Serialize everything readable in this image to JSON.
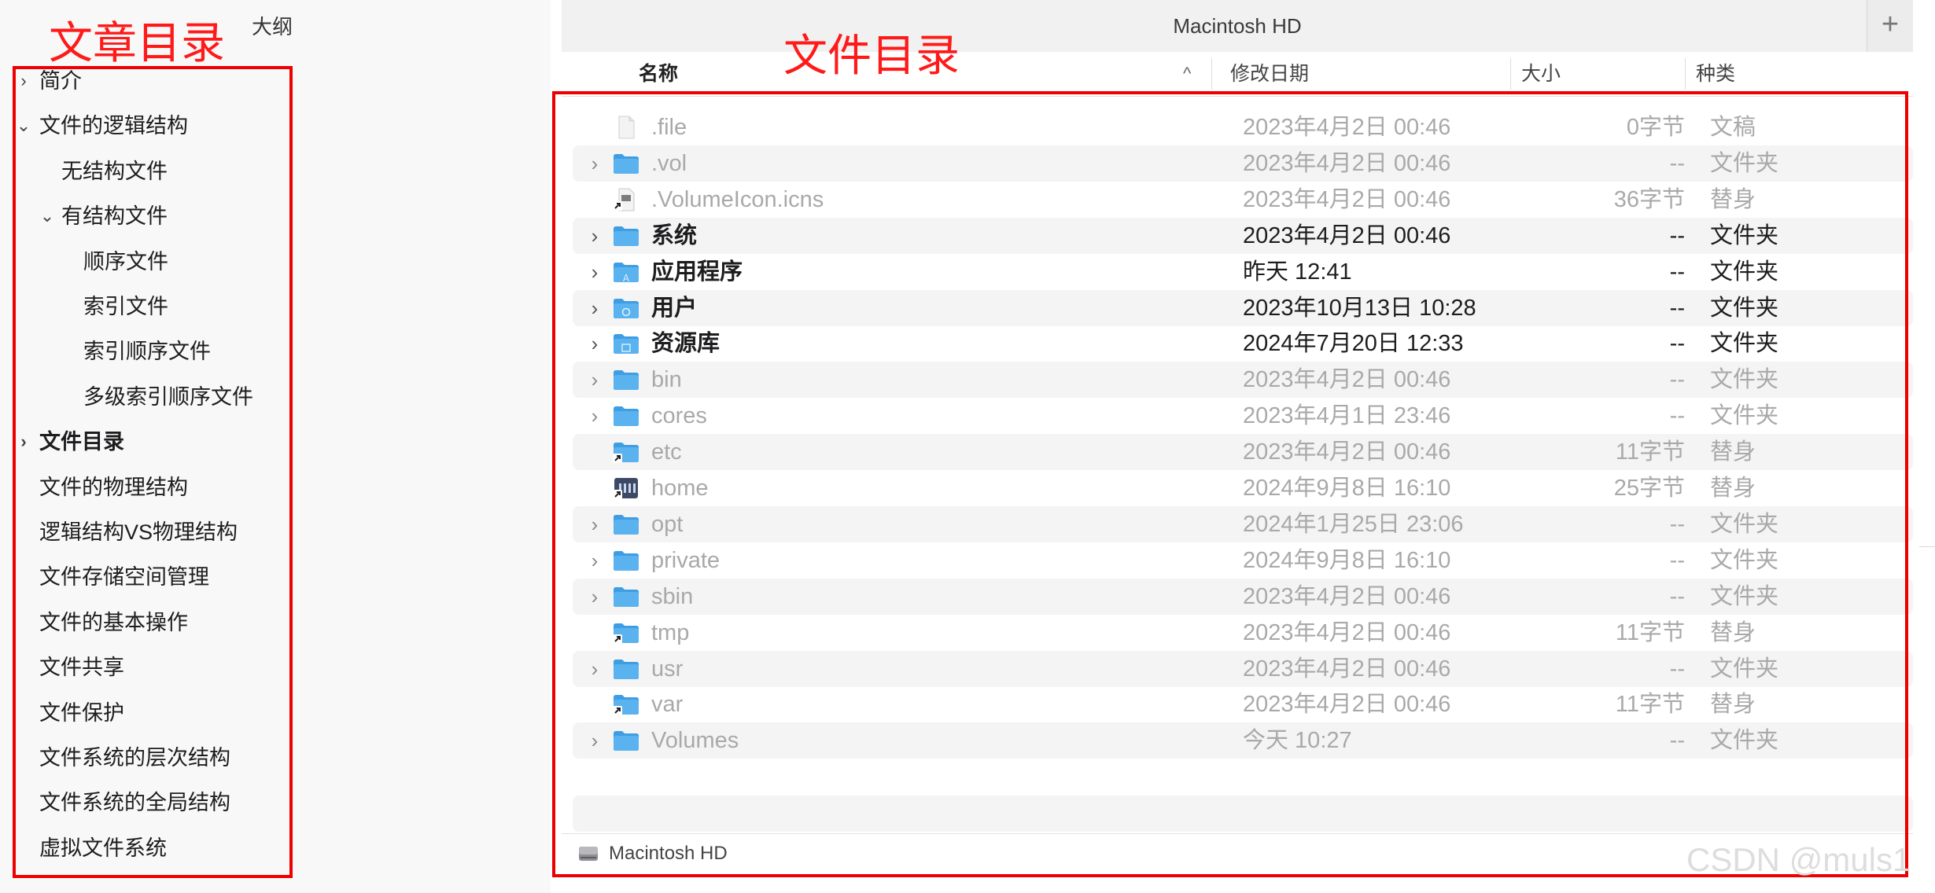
{
  "outline": {
    "header": "大纲",
    "items": [
      {
        "label": "简介",
        "chevron": "›",
        "level": 0,
        "bold": false
      },
      {
        "label": "文件的逻辑结构",
        "chevron": "⌄",
        "level": 0,
        "bold": false
      },
      {
        "label": "无结构文件",
        "chevron": "",
        "level": 1,
        "bold": false
      },
      {
        "label": "有结构文件",
        "chevron": "⌄",
        "level": 1,
        "bold": false
      },
      {
        "label": "顺序文件",
        "chevron": "",
        "level": 2,
        "bold": false
      },
      {
        "label": "索引文件",
        "chevron": "",
        "level": 2,
        "bold": false
      },
      {
        "label": "索引顺序文件",
        "chevron": "",
        "level": 2,
        "bold": false
      },
      {
        "label": "多级索引顺序文件",
        "chevron": "",
        "level": 2,
        "bold": false
      },
      {
        "label": "文件目录",
        "chevron": "›",
        "level": 0,
        "bold": true
      },
      {
        "label": "文件的物理结构",
        "chevron": "",
        "level": 0,
        "bold": false
      },
      {
        "label": "逻辑结构VS物理结构",
        "chevron": "",
        "level": 0,
        "bold": false
      },
      {
        "label": "文件存储空间管理",
        "chevron": "",
        "level": 0,
        "bold": false
      },
      {
        "label": "文件的基本操作",
        "chevron": "",
        "level": 0,
        "bold": false
      },
      {
        "label": "文件共享",
        "chevron": "",
        "level": 0,
        "bold": false
      },
      {
        "label": "文件保护",
        "chevron": "",
        "level": 0,
        "bold": false
      },
      {
        "label": "文件系统的层次结构",
        "chevron": "",
        "level": 0,
        "bold": false
      },
      {
        "label": "文件系统的全局结构",
        "chevron": "",
        "level": 0,
        "bold": false
      },
      {
        "label": "虚拟文件系统",
        "chevron": "",
        "level": 0,
        "bold": false
      }
    ]
  },
  "annotations": {
    "article_toc": "文章目录",
    "file_directory": "文件目录",
    "color": "#ff1a1a"
  },
  "finder": {
    "title": "Macintosh HD",
    "add_button": "+",
    "columns": {
      "name": "名称",
      "date": "修改日期",
      "size": "大小",
      "kind": "种类",
      "sort_indicator": "^"
    },
    "rows": [
      {
        "name": ".file",
        "date": "2023年4月2日 00:46",
        "size": "0字节",
        "kind": "文稿",
        "expandable": false,
        "icon": "document-icon",
        "style": "dim"
      },
      {
        "name": ".vol",
        "date": "2023年4月2日 00:46",
        "size": "--",
        "kind": "文件夹",
        "expandable": true,
        "icon": "folder-icon",
        "style": "dim"
      },
      {
        "name": ".VolumeIcon.icns",
        "date": "2023年4月2日 00:46",
        "size": "36字节",
        "kind": "替身",
        "expandable": false,
        "icon": "alias-icon",
        "style": "dim"
      },
      {
        "name": "系统",
        "date": "2023年4月2日 00:46",
        "size": "--",
        "kind": "文件夹",
        "expandable": true,
        "icon": "folder-icon",
        "style": "strong"
      },
      {
        "name": "应用程序",
        "date": "昨天 12:41",
        "size": "--",
        "kind": "文件夹",
        "expandable": true,
        "icon": "applications-folder-icon",
        "style": "strong"
      },
      {
        "name": "用户",
        "date": "2023年10月13日 10:28",
        "size": "--",
        "kind": "文件夹",
        "expandable": true,
        "icon": "users-folder-icon",
        "style": "strong"
      },
      {
        "name": "资源库",
        "date": "2024年7月20日 12:33",
        "size": "--",
        "kind": "文件夹",
        "expandable": true,
        "icon": "library-folder-icon",
        "style": "strong"
      },
      {
        "name": "bin",
        "date": "2023年4月2日 00:46",
        "size": "--",
        "kind": "文件夹",
        "expandable": true,
        "icon": "folder-icon",
        "style": "dim"
      },
      {
        "name": "cores",
        "date": "2023年4月1日 23:46",
        "size": "--",
        "kind": "文件夹",
        "expandable": true,
        "icon": "folder-icon",
        "style": "dim"
      },
      {
        "name": "etc",
        "date": "2023年4月2日 00:46",
        "size": "11字节",
        "kind": "替身",
        "expandable": false,
        "icon": "alias-folder-icon",
        "style": "dim"
      },
      {
        "name": "home",
        "date": "2024年9月8日 16:10",
        "size": "25字节",
        "kind": "替身",
        "expandable": false,
        "icon": "home-alias-icon",
        "style": "dim"
      },
      {
        "name": "opt",
        "date": "2024年1月25日 23:06",
        "size": "--",
        "kind": "文件夹",
        "expandable": true,
        "icon": "folder-icon",
        "style": "dim"
      },
      {
        "name": "private",
        "date": "2024年9月8日 16:10",
        "size": "--",
        "kind": "文件夹",
        "expandable": true,
        "icon": "folder-icon",
        "style": "dim"
      },
      {
        "name": "sbin",
        "date": "2023年4月2日 00:46",
        "size": "--",
        "kind": "文件夹",
        "expandable": true,
        "icon": "folder-icon",
        "style": "dim"
      },
      {
        "name": "tmp",
        "date": "2023年4月2日 00:46",
        "size": "11字节",
        "kind": "替身",
        "expandable": false,
        "icon": "alias-folder-icon",
        "style": "dim"
      },
      {
        "name": "usr",
        "date": "2023年4月2日 00:46",
        "size": "--",
        "kind": "文件夹",
        "expandable": true,
        "icon": "folder-icon",
        "style": "dim"
      },
      {
        "name": "var",
        "date": "2023年4月2日 00:46",
        "size": "11字节",
        "kind": "替身",
        "expandable": false,
        "icon": "alias-folder-icon",
        "style": "dim"
      },
      {
        "name": "Volumes",
        "date": "今天 10:27",
        "size": "--",
        "kind": "文件夹",
        "expandable": true,
        "icon": "folder-icon",
        "style": "dim"
      }
    ],
    "path_bar": {
      "label": "Macintosh HD",
      "icon": "hard-drive-icon"
    }
  },
  "watermark": "CSDN @muls1",
  "colors": {
    "folder": "#5ab2ef",
    "folder_dark": "#3f9ee3",
    "annotation_red": "#ee0000"
  }
}
